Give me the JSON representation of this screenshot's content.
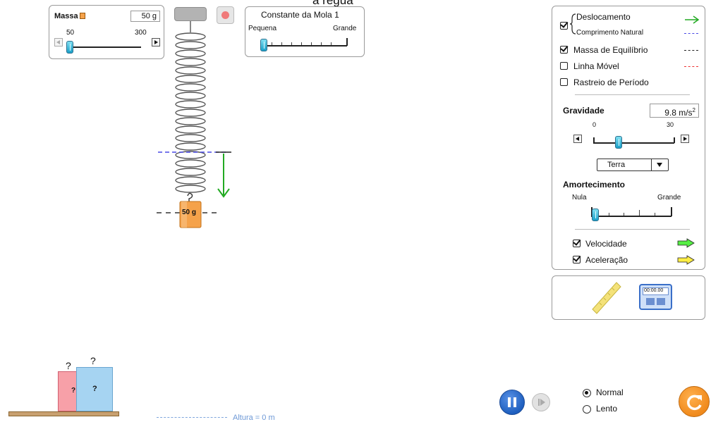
{
  "title_fragment": "a régua",
  "mass_panel": {
    "label": "Massa",
    "value": "50 g",
    "min": "50",
    "max": "300",
    "level": 0.0
  },
  "spring_panel": {
    "title": "Constante da Mola 1",
    "min_label": "Pequena",
    "max_label": "Grande",
    "level": 0.0
  },
  "weight_label": "50 g",
  "unknown_mark": "?",
  "height_label": "Altura = 0 m",
  "options": {
    "deslocamento": "Deslocamento",
    "comprimento_natural": "Comprimento Natural",
    "massa_equilibrio": "Massa de Equilíbrio",
    "linha_movel": "Linha Móvel",
    "rastreio_periodo": "Rastreio de Período"
  },
  "gravity": {
    "label": "Gravidade",
    "value": "9.8 m/s",
    "superscript": "2",
    "min": "0",
    "max": "30",
    "level": 0.33,
    "preset": "Terra"
  },
  "damping": {
    "label": "Amortecimento",
    "min_label": "Nula",
    "max_label": "Grande",
    "level": 0.0
  },
  "vectors": {
    "velocidade": "Velocidade",
    "aceleracao": "Aceleração"
  },
  "timer_text": "00:00.00",
  "speed": {
    "normal": "Normal",
    "lento": "Lento",
    "selected": "Normal"
  },
  "colors": {
    "green_arrow": "#22aa22",
    "blue_dash": "#4a4ae6",
    "red_dash": "#ee3333",
    "mass_orange": "#f5a24a",
    "accent_cyan": "#1aa0c8",
    "pause_blue": "#1e5fbf",
    "reset_orange": "#f08a1c"
  }
}
